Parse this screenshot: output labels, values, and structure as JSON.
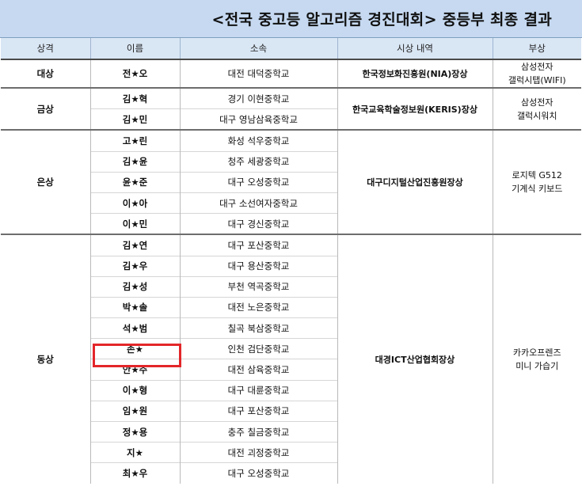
{
  "title": "<전국 중고등 알고리즘 경진대회> 중등부 최종 결과",
  "headers": [
    "상격",
    "이름",
    "소속",
    "시상 내역",
    "부상"
  ],
  "groups": [
    {
      "prize": "대상",
      "award": "한국정보화진흥원(NIA)장상",
      "gift": [
        "삼성전자",
        "갤럭시탭(WIFI)"
      ],
      "rows": [
        {
          "name": "전★오",
          "school": "대전 대덕중학교"
        }
      ]
    },
    {
      "prize": "금상",
      "award": "한국교육학술정보원(KERIS)장상",
      "gift": [
        "삼성전자",
        "갤럭시워치"
      ],
      "rows": [
        {
          "name": "김★혁",
          "school": "경기 이현중학교"
        },
        {
          "name": "김★민",
          "school": "대구 영남삼육중학교"
        }
      ]
    },
    {
      "prize": "은상",
      "award": "대구디지털산업진흥원장상",
      "gift": [
        "로지텍 G512",
        "기계식 키보드"
      ],
      "rows": [
        {
          "name": "고★린",
          "school": "화성 석우중학교"
        },
        {
          "name": "김★윤",
          "school": "청주 세광중학교"
        },
        {
          "name": "윤★준",
          "school": "대구 오성중학교"
        },
        {
          "name": "이★아",
          "school": "대구 소선여자중학교"
        },
        {
          "name": "이★민",
          "school": "대구 경신중학교"
        }
      ]
    },
    {
      "prize": "동상",
      "award": "대경ICT산업협회장상",
      "gift": [
        "카카오프렌즈",
        "미니 가습기"
      ],
      "rows": [
        {
          "name": "김★연",
          "school": "대구 포산중학교"
        },
        {
          "name": "김★우",
          "school": "대구 용산중학교"
        },
        {
          "name": "김★성",
          "school": "부천 역곡중학교"
        },
        {
          "name": "박★솔",
          "school": "대전 노은중학교"
        },
        {
          "name": "석★범",
          "school": "칠곡 북삼중학교"
        },
        {
          "name": "손★",
          "school": "인천 검단중학교",
          "highlighted": true
        },
        {
          "name": "안★주",
          "school": "대전 삼육중학교"
        },
        {
          "name": "이★형",
          "school": "대구 대륜중학교"
        },
        {
          "name": "임★원",
          "school": "대구 포산중학교"
        },
        {
          "name": "정★용",
          "school": "충주 칠금중학교"
        },
        {
          "name": "지★",
          "school": "대전 괴정중학교"
        },
        {
          "name": "최★우",
          "school": "대구 오성중학교"
        }
      ]
    }
  ]
}
